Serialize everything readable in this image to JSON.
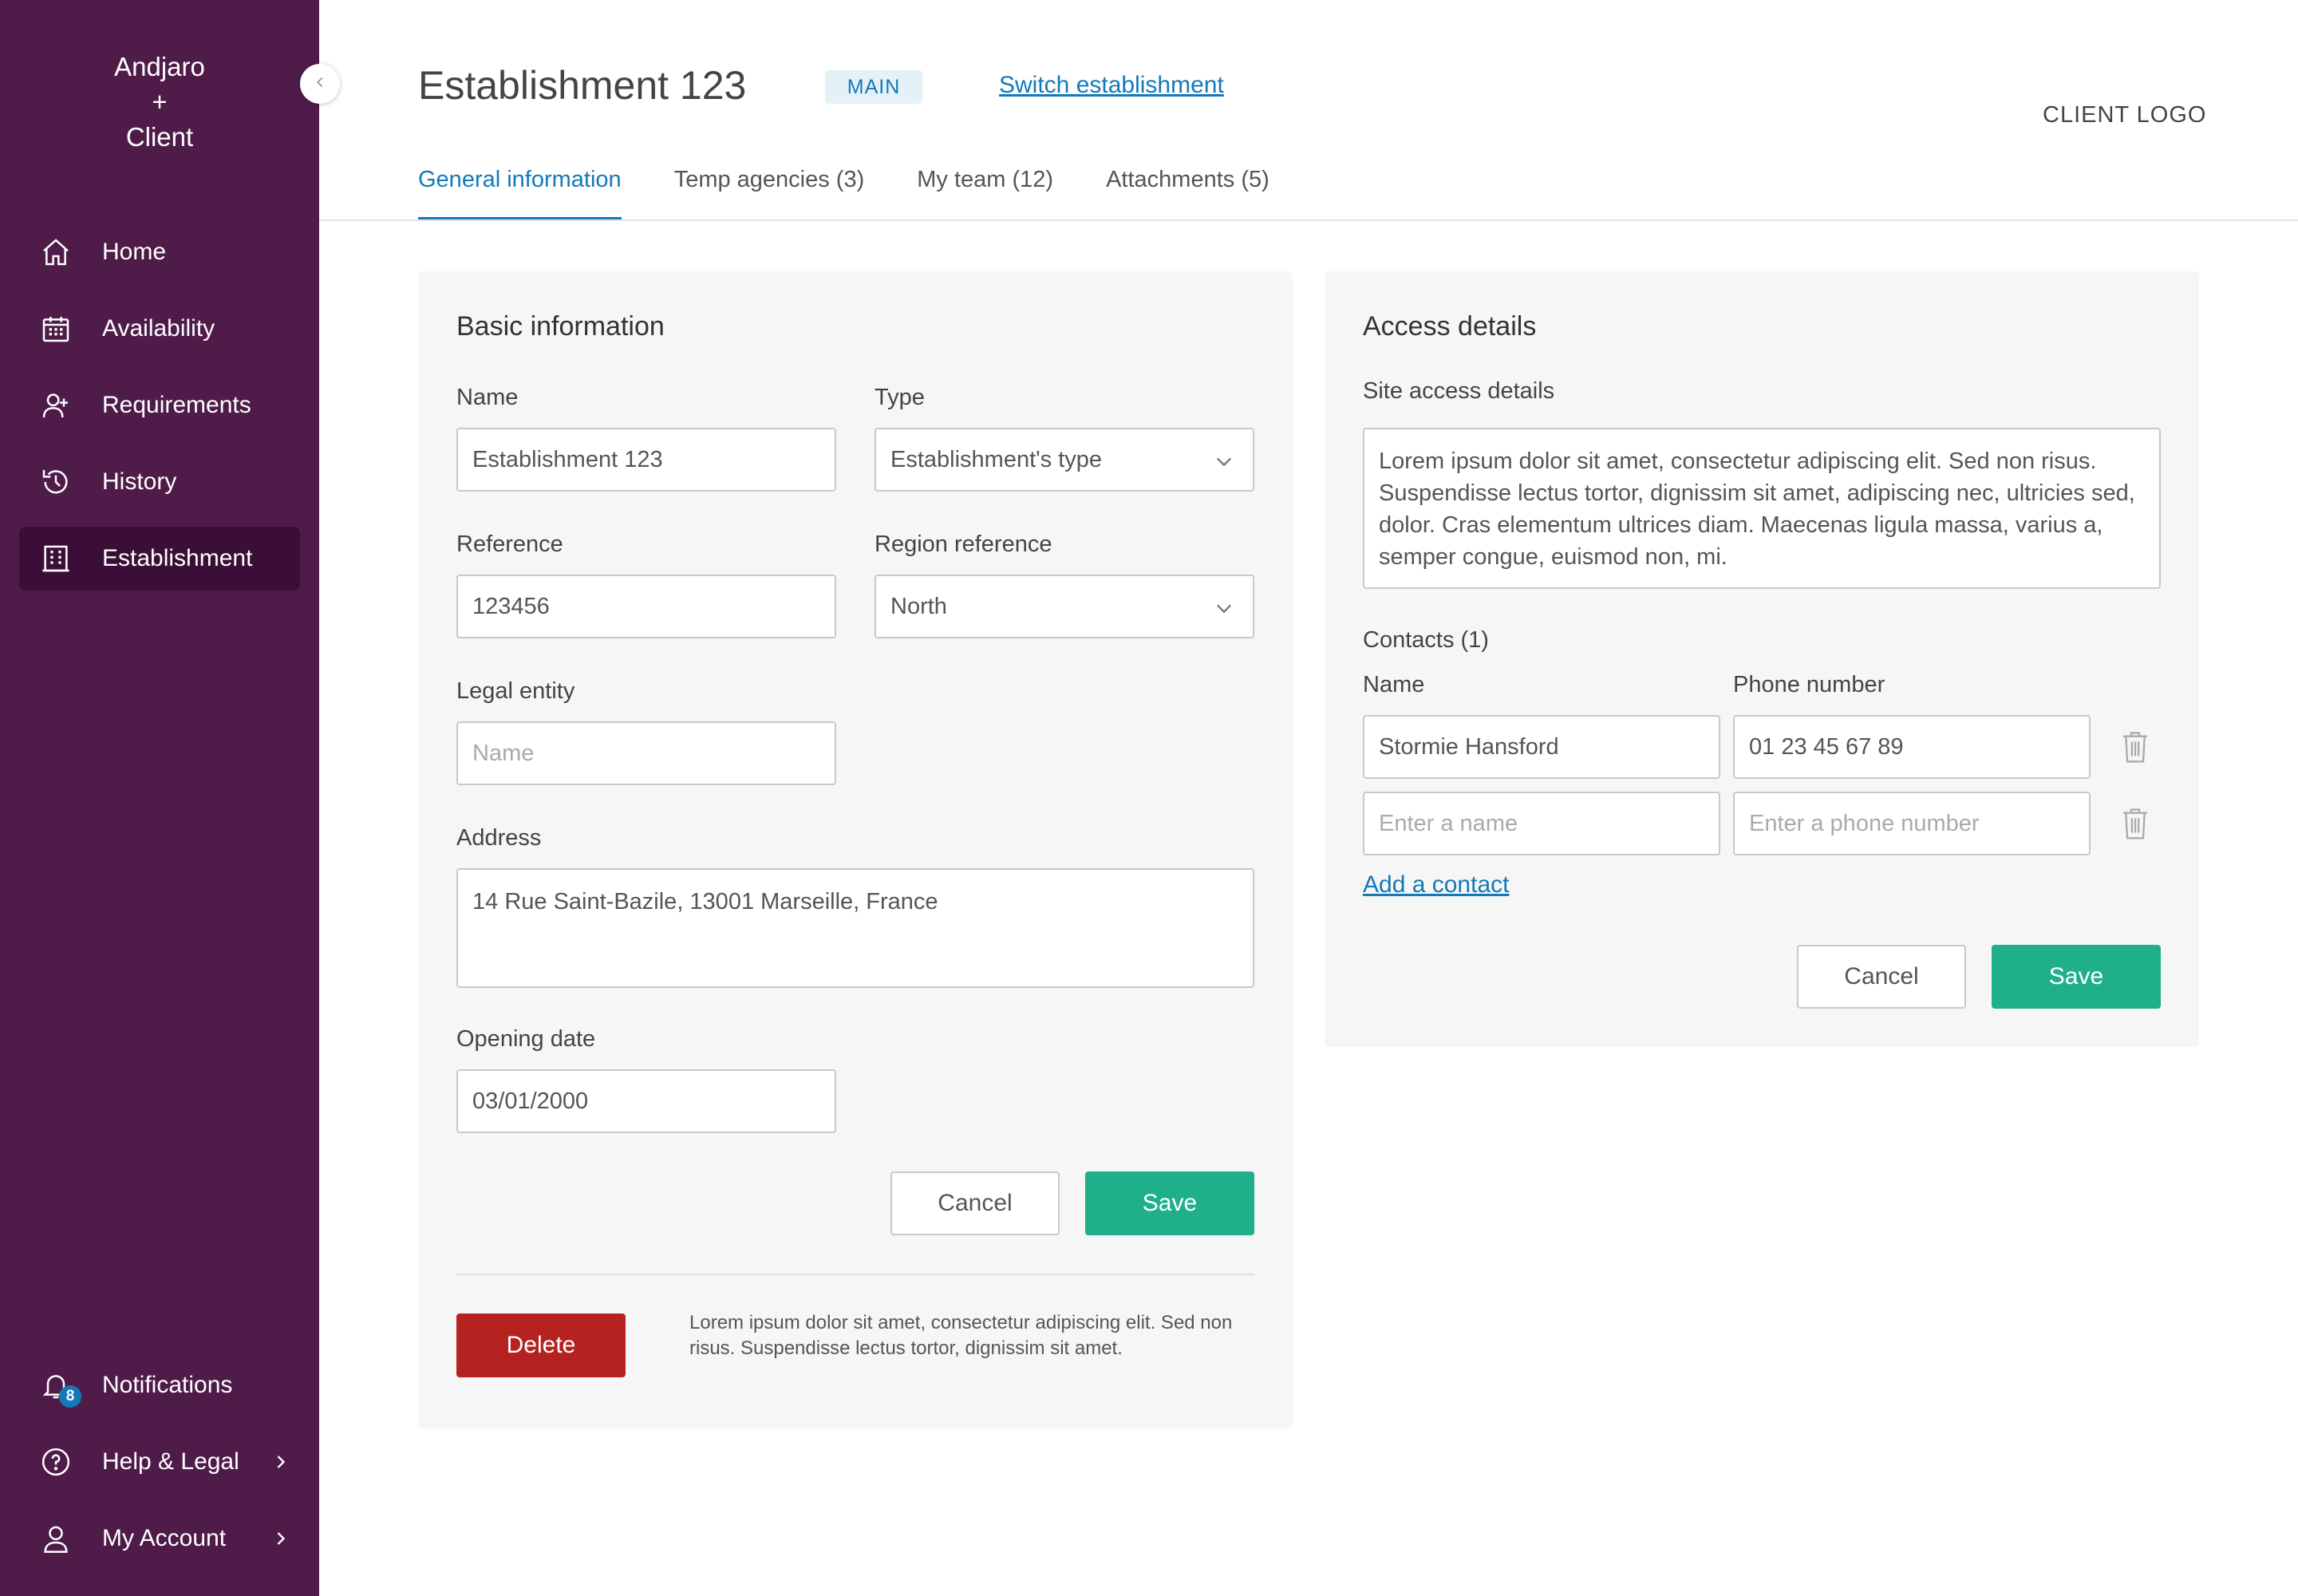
{
  "sidebar": {
    "brand_line1": "Andjaro",
    "brand_line2": "+",
    "brand_line3": "Client",
    "items": [
      {
        "label": "Home",
        "icon": "home-icon"
      },
      {
        "label": "Availability",
        "icon": "calendar-icon"
      },
      {
        "label": "Requirements",
        "icon": "add-user-icon"
      },
      {
        "label": "History",
        "icon": "history-icon"
      },
      {
        "label": "Establishment",
        "icon": "building-icon",
        "active": true
      }
    ],
    "bottom_items": [
      {
        "label": "Notifications",
        "icon": "bell-icon",
        "badge": "8"
      },
      {
        "label": "Help & Legal",
        "icon": "help-icon"
      },
      {
        "label": "My Account",
        "icon": "user-icon"
      }
    ]
  },
  "header": {
    "title": "Establishment 123",
    "badge": "MAIN",
    "switch_link": "Switch establishment",
    "client_logo": "CLIENT LOGO"
  },
  "tabs": [
    {
      "label": "General information",
      "active": true
    },
    {
      "label": "Temp agencies (3)"
    },
    {
      "label": "My team (12)"
    },
    {
      "label": "Attachments (5)"
    }
  ],
  "basic": {
    "title": "Basic information",
    "name_label": "Name",
    "name_value": "Establishment 123",
    "type_label": "Type",
    "type_value": "Establishment's type",
    "reference_label": "Reference",
    "reference_value": "123456",
    "region_label": "Region reference",
    "region_value": "North",
    "legal_label": "Legal entity",
    "legal_value": "Name",
    "address_label": "Address",
    "address_value": "14 Rue Saint-Bazile, 13001 Marseille, France",
    "opening_label": "Opening date",
    "opening_value": "03/01/2000",
    "cancel": "Cancel",
    "save": "Save",
    "delete": "Delete",
    "delete_note": "Lorem ipsum dolor sit amet, consectetur adipiscing elit. Sed non risus. Suspendisse lectus tortor, dignissim sit amet."
  },
  "access": {
    "title": "Access details",
    "site_label": "Site access details",
    "site_value": "Lorem ipsum dolor sit amet, consectetur adipiscing elit. Sed non risus. Suspendisse lectus tortor, dignissim sit amet, adipiscing nec, ultricies sed, dolor. Cras elementum ultrices diam. Maecenas ligula massa, varius a, semper congue, euismod non, mi.",
    "contacts_label": "Contacts (1)",
    "col_name": "Name",
    "col_phone": "Phone number",
    "contacts": [
      {
        "name": "Stormie Hansford",
        "phone": "01 23 45 67 89"
      }
    ],
    "name_placeholder": "Enter a name",
    "phone_placeholder": "Enter a phone number",
    "add_contact": "Add a contact",
    "cancel": "Cancel",
    "save": "Save"
  },
  "colors": {
    "sidebar": "#4f1c4a",
    "sidebar_active": "#3a0e36",
    "accent": "#1479b8",
    "save": "#1fb08a",
    "delete": "#b42320"
  }
}
